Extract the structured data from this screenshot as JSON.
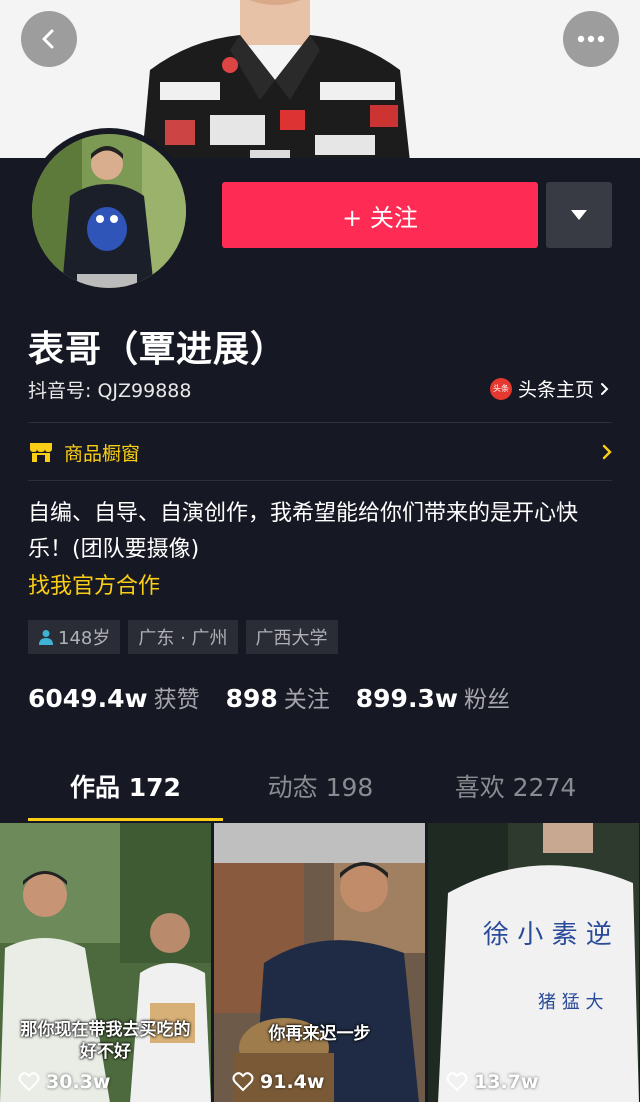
{
  "header": {
    "back_icon": "chevron-left-icon",
    "more_icon": "ellipsis-icon"
  },
  "profile": {
    "follow_label": "+ 关注",
    "name": "表哥（覃进展）",
    "douyin_id": "抖音号: QJZ99888",
    "toutiao_badge": "头条",
    "toutiao_label": "头条主页",
    "shop_label": "商品橱窗",
    "bio": "自编、自导、自演创作，我希望能给你们带来的是开心快乐！(团队要摄像)",
    "bio_link": "找我官方合作",
    "tags": {
      "age": "148岁",
      "location": "广东 · 广州",
      "school": "广西大学"
    },
    "stats": {
      "likes_num": "6049.4w",
      "likes_label": "获赞",
      "following_num": "898",
      "following_label": "关注",
      "followers_num": "899.3w",
      "followers_label": "粉丝"
    }
  },
  "tabs": [
    {
      "label": "作品 172"
    },
    {
      "label": "动态 198"
    },
    {
      "label": "喜欢 2274"
    }
  ],
  "videos": [
    {
      "caption_line1": "那你现在带我去买吃的",
      "caption_line2": "好不好",
      "likes": "30.3w"
    },
    {
      "caption_line1": "你再来迟一步",
      "likes": "91.4w"
    },
    {
      "likes": "13.7w"
    }
  ],
  "colors": {
    "accent": "#fe2c55",
    "highlight": "#face15",
    "background": "#161823"
  }
}
